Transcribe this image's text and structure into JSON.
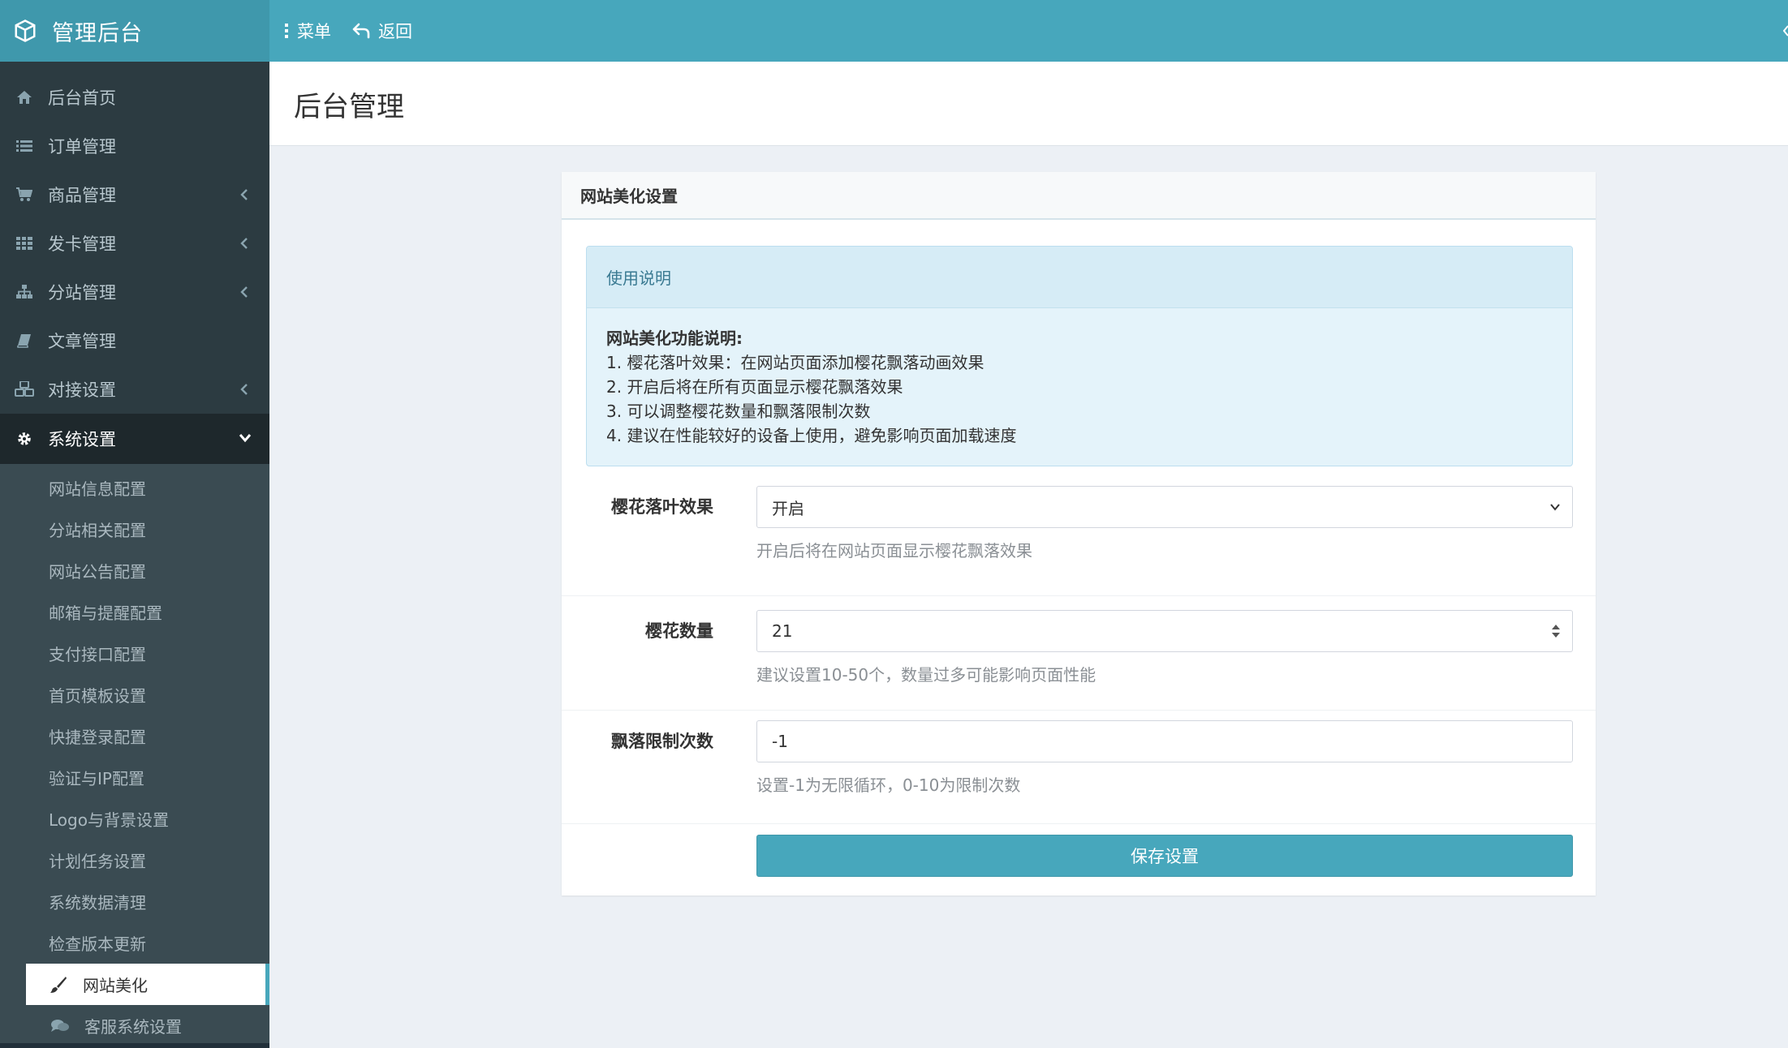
{
  "app": {
    "title": "管理后台"
  },
  "topnav": {
    "menu_label": "菜单",
    "back_label": "返回"
  },
  "sidebar": {
    "items": [
      {
        "label": "后台首页",
        "icon": "home-icon"
      },
      {
        "label": "订单管理",
        "icon": "list-icon"
      },
      {
        "label": "商品管理",
        "icon": "cart-icon",
        "has_children": true
      },
      {
        "label": "发卡管理",
        "icon": "grid-icon",
        "has_children": true
      },
      {
        "label": "分站管理",
        "icon": "sitemap-icon",
        "has_children": true
      },
      {
        "label": "文章管理",
        "icon": "book-icon"
      },
      {
        "label": "对接设置",
        "icon": "cubes-icon",
        "has_children": true
      },
      {
        "label": "系统设置",
        "icon": "gear-icon",
        "has_children": true,
        "expanded": true
      }
    ],
    "submenu": [
      "网站信息配置",
      "分站相关配置",
      "网站公告配置",
      "邮箱与提醒配置",
      "支付接口配置",
      "首页模板设置",
      "快捷登录配置",
      "验证与IP配置",
      "Logo与背景设置",
      "计划任务设置",
      "系统数据清理",
      "检查版本更新"
    ],
    "selected_sub": {
      "label": "网站美化",
      "icon": "brush-icon"
    },
    "next_sub": {
      "label": "客服系统设置",
      "icon": "comments-icon"
    }
  },
  "content": {
    "page_title": "后台管理"
  },
  "panel": {
    "heading": "网站美化设置",
    "notice": {
      "title": "使用说明",
      "head": "网站美化功能说明:",
      "lines": [
        "1. 樱花落叶效果：在网站页面添加樱花飘落动画效果",
        "2. 开启后将在所有页面显示樱花飘落效果",
        "3. 可以调整樱花数量和飘落限制次数",
        "4. 建议在性能较好的设备上使用，避免影响页面加载速度"
      ]
    },
    "fields": {
      "effect": {
        "label": "樱花落叶效果",
        "value": "开启",
        "help": "开启后将在网站页面显示樱花飘落效果"
      },
      "count": {
        "label": "樱花数量",
        "value": "21",
        "help": "建议设置10-50个，数量过多可能影响页面性能"
      },
      "limit": {
        "label": "飘落限制次数",
        "value": "-1",
        "help": "设置-1为无限循环，0-10为限制次数"
      }
    },
    "save_label": "保存设置"
  },
  "colors": {
    "header": "#47a7bc",
    "logo_bg": "#3f98ac",
    "sidebar": "#2c3b41",
    "submenu": "#3a4b52",
    "accent": "#47a7bc"
  }
}
